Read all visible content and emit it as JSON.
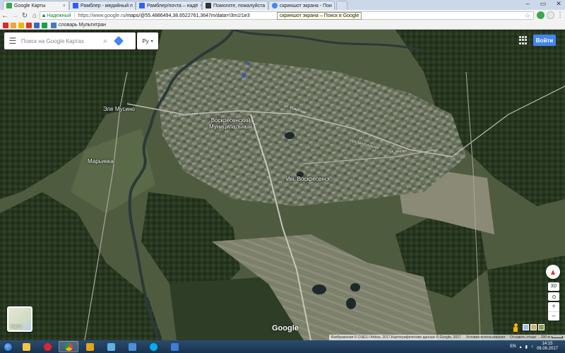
{
  "browser": {
    "tabs": [
      {
        "label": "Google Карты",
        "icon": "google-maps-icon",
        "color": "#34a853",
        "active": true
      },
      {
        "label": "Рамблер - медийный п",
        "icon": "rambler-icon",
        "color": "#315efb",
        "active": false
      },
      {
        "label": "Рамблер/почта – надё",
        "icon": "rambler-mail-icon",
        "color": "#315efb",
        "active": false
      },
      {
        "label": "Помогите, пожалуйста",
        "icon": "site-icon",
        "color": "#333333",
        "active": false
      },
      {
        "label": "скриншот экрана - Пои",
        "icon": "google-search-icon",
        "color": "#4285f4",
        "active": false
      }
    ],
    "tooltip": "скриншот экрана – Поиск в Google",
    "secure_label": "Надежный",
    "url_host": "https://www.google.ru",
    "url_path": "/maps/@55.4886494,38.6522761,3647m/data=!3m1!1e3",
    "bookmarks": [
      {
        "label": "словарь Мультитран",
        "icon": "multitran-icon"
      }
    ]
  },
  "map": {
    "search_placeholder": "Поиск на Google Картах",
    "language": "Ру",
    "signin_label": "Войти",
    "labels": [
      {
        "text": "Воскресенский\nМуниципальный",
        "kind": "town"
      },
      {
        "text": "Эле Мусино",
        "kind": "village"
      },
      {
        "text": "Марьинка",
        "kind": "village"
      },
      {
        "text": "Им. Воскресенск",
        "kind": "village"
      }
    ],
    "road_labels": [
      "ул. Вокзальная",
      "ул. Советская",
      "ул. Центральная",
      "ул. Мира"
    ],
    "layer_label": "Карта",
    "google_logo": "Google",
    "btn_3d": "3D",
    "zoom_in": "+",
    "zoom_out": "−",
    "attribution": "Изображения © CNES / Airbus, 2017,Картографические данные © Google, 2017",
    "terms": "Условия использования",
    "feedback": "Оставить отзыв",
    "scale": "200 м"
  },
  "taskbar": {
    "apps": [
      {
        "name": "explorer",
        "icon": "folder-icon",
        "color": "#f5c542"
      },
      {
        "name": "opera",
        "icon": "opera-icon",
        "color": "#e0242f"
      },
      {
        "name": "chrome",
        "icon": "chrome-icon",
        "color": "#34a853",
        "active": true
      },
      {
        "name": "outlook",
        "icon": "outlook-icon",
        "color": "#e8a317"
      },
      {
        "name": "paint",
        "icon": "paint-icon",
        "color": "#5fb0e8"
      },
      {
        "name": "notes",
        "icon": "notes-icon",
        "color": "#4a90d9"
      },
      {
        "name": "skype",
        "icon": "skype-icon",
        "color": "#00aff0"
      },
      {
        "name": "gallery",
        "icon": "gallery-icon",
        "color": "#3b7dd8"
      }
    ],
    "lang": "EN",
    "time": "14:15",
    "date": "06.06.2017"
  }
}
